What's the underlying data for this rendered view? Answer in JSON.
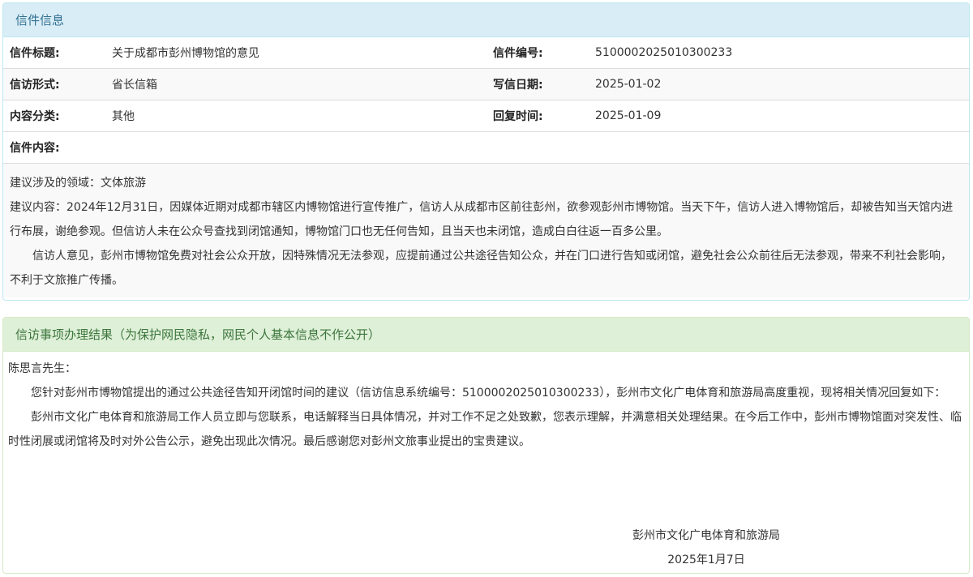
{
  "letter_panel": {
    "heading": "信件信息",
    "rows": [
      {
        "label1": "信件标题:",
        "value1": "关于成都市彭州博物馆的意见",
        "label2": "信件编号:",
        "value2": "5100002025010300233"
      },
      {
        "label1": "信访形式:",
        "value1": "省长信箱",
        "label2": "写信日期:",
        "value2": "2025-01-02"
      },
      {
        "label1": "内容分类:",
        "value1": "其他",
        "label2": "回复时间:",
        "value2": "2025-01-09"
      }
    ],
    "content_label": "信件内容:",
    "content": {
      "field": "建议涉及的领域：文体旅游",
      "suggestion": "建议内容：2024年12月31日，因媒体近期对成都市辖区内博物馆进行宣传推广，信访人从成都市区前往彭州，欲参观彭州市博物馆。当天下午，信访人进入博物馆后，却被告知当天馆内进行布展，谢绝参观。但信访人未在公众号查找到闭馆通知，博物馆门口也无任何告知，且当天也未闭馆，造成白白往返一百多公里。",
      "opinion": "信访人意见，彭州市博物馆免费对社会公众开放，因特殊情况无法参观，应提前通过公共途径告知公众，并在门口进行告知或闭馆，避免社会公众前往后无法参观，带来不利社会影响，不利于文旅推广传播。"
    }
  },
  "result_panel": {
    "heading": "信访事项办理结果（为保护网民隐私，网民个人基本信息不作公开）",
    "salutation": "陈思言先生：",
    "paragraph1": "您针对彭州市博物馆提出的通过公共途径告知开闭馆时间的建议（信访信息系统编号：5100002025010300233），彭州市文化广电体育和旅游局高度重视，现将相关情况回复如下：",
    "paragraph2": "彭州市文化广电体育和旅游局工作人员立即与您联系，电话解释当日具体情况，并对工作不足之处致歉，您表示理解，并满意相关处理结果。在今后工作中，彭州市博物馆面对突发性、临时性闭展或闭馆将及时对外公告公示，避免出现此次情况。最后感谢您对彭州文旅事业提出的宝贵建议。",
    "signature": "彭州市文化广电体育和旅游局",
    "date": "2025年1月7日"
  }
}
